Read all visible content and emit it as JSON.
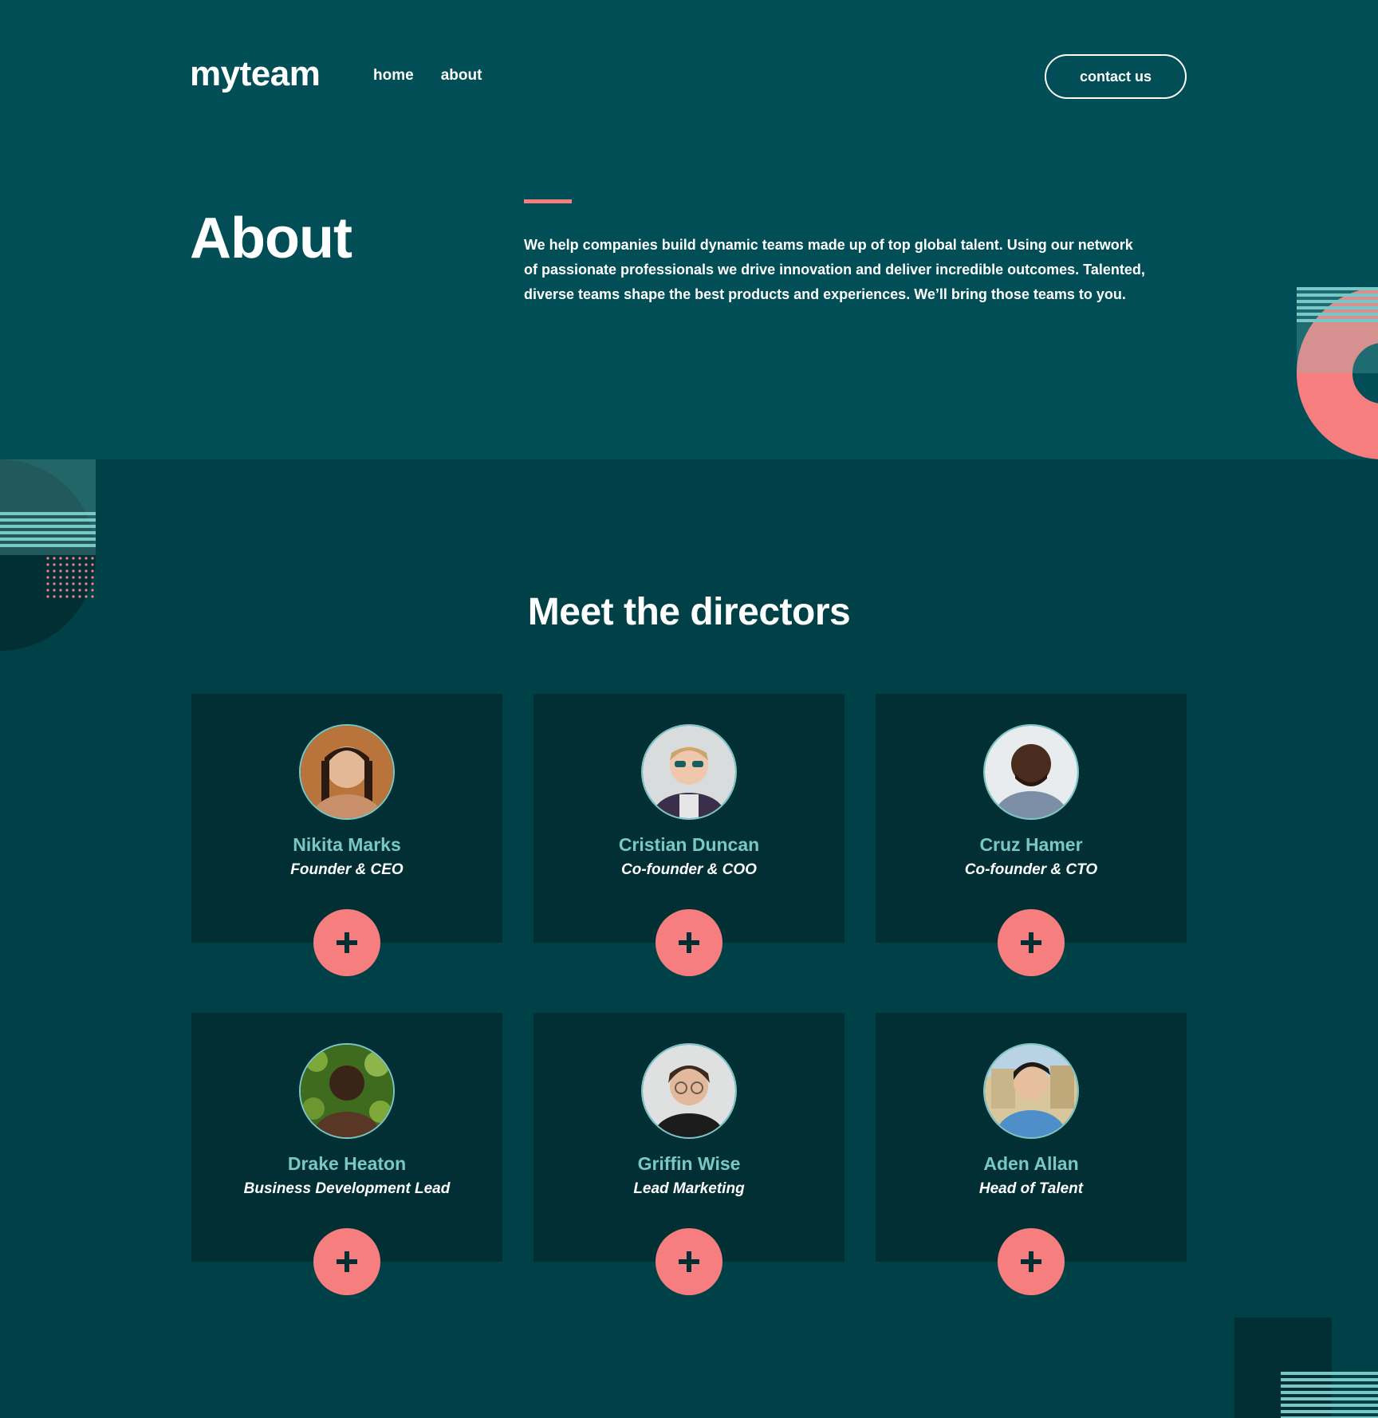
{
  "header": {
    "logo": "myteam",
    "nav": [
      "home",
      "about"
    ],
    "contact_label": "contact us"
  },
  "about": {
    "title": "About",
    "text": "We help companies build dynamic teams made up of top global talent. Using our network of passionate professionals we drive innovation and deliver incredible outcomes. Talented, diverse teams shape the best products and experiences. We’ll bring those teams to you."
  },
  "directors": {
    "title": "Meet the directors",
    "people": [
      {
        "name": "Nikita Marks",
        "role": "Founder & CEO"
      },
      {
        "name": "Cristian Duncan",
        "role": "Co-founder & COO"
      },
      {
        "name": "Cruz Hamer",
        "role": "Co-founder & CTO"
      },
      {
        "name": "Drake Heaton",
        "role": "Business Development Lead"
      },
      {
        "name": "Griffin Wise",
        "role": "Lead Marketing"
      },
      {
        "name": "Aden Allan",
        "role": "Head of Talent"
      }
    ],
    "expand_icon": "plus-icon"
  },
  "colors": {
    "top_bg": "#014e56",
    "section_bg": "#004047",
    "card_bg": "#012f34",
    "accent_coral": "#f67e7e",
    "accent_teal": "#79c8c7"
  }
}
